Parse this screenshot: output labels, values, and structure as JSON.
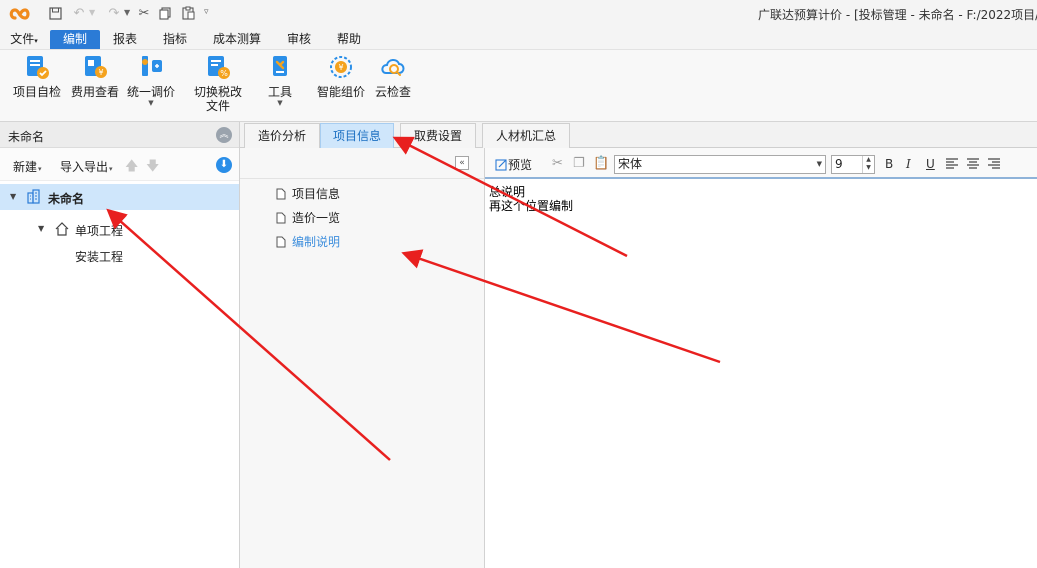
{
  "window": {
    "title": "广联达预算计价 - [投标管理 - 未命名 - F:/2022项目/"
  },
  "quick_access": {
    "icons": [
      "save-icon",
      "undo-icon",
      "redo-icon",
      "cut-icon",
      "copy-icon",
      "paste-icon",
      "customize-icon"
    ]
  },
  "menu": {
    "items": [
      "文件",
      "编制",
      "报表",
      "指标",
      "成本测算",
      "审核",
      "帮助"
    ],
    "active": "编制"
  },
  "ribbon": {
    "buttons": [
      {
        "label": "项目自检",
        "icon": "project-check-icon"
      },
      {
        "label": "费用查看",
        "icon": "fee-view-icon"
      },
      {
        "label": "统一调价",
        "icon": "price-adjust-icon"
      },
      {
        "label": "切换税改",
        "label2": "文件",
        "icon": "tax-switch-icon"
      },
      {
        "label": "工具",
        "icon": "tools-icon"
      },
      {
        "label": "智能组价",
        "icon": "smart-pricing-icon"
      },
      {
        "label": "云检查",
        "icon": "cloud-check-icon"
      }
    ]
  },
  "left_panel": {
    "title": "未命名",
    "new_label": "新建",
    "import_export_label": "导入导出",
    "tree": [
      {
        "label": "未命名",
        "level": 0,
        "selected": true
      },
      {
        "label": "单项工程",
        "level": 1
      },
      {
        "label": "安装工程",
        "level": 2
      }
    ]
  },
  "tabs": {
    "items": [
      "造价分析",
      "项目信息",
      "取费设置",
      "人材机汇总"
    ],
    "active": "项目信息"
  },
  "nav": {
    "items": [
      "项目信息",
      "造价一览",
      "编制说明"
    ],
    "active": "编制说明"
  },
  "editor": {
    "preview_label": "预览",
    "font": "宋体",
    "font_size": "9",
    "format_buttons": {
      "bold": "B",
      "italic": "I",
      "underline": "U"
    },
    "content": [
      "总说明",
      "再这个位置编制"
    ]
  },
  "colors": {
    "accent": "#2b7bd6",
    "selection": "#cfe6fb",
    "annotation": "#e8201f"
  }
}
